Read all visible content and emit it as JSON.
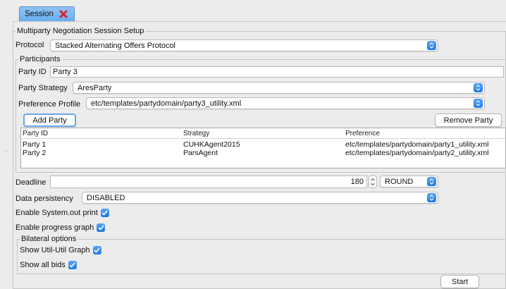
{
  "tab": {
    "label": "Session"
  },
  "setup": {
    "legend": "Multiparty Negotiation Session Setup",
    "protocol_label": "Protocol",
    "protocol_value": "Stacked Alternating Offers Protocol"
  },
  "participants": {
    "legend": "Participants",
    "party_id_label": "Party ID",
    "party_id_value": "Party 3",
    "strategy_label": "Party Strategy",
    "strategy_value": "AresParty",
    "profile_label": "Preference Profile",
    "profile_value": "etc/templates/partydomain/party3_utility.xml",
    "add_button": "Add Party",
    "remove_button": "Remove Party",
    "table": {
      "headers": [
        "Party ID",
        "Strategy",
        "Preference"
      ],
      "rows": [
        [
          "Party 1",
          "CUHKAgent2015",
          "etc/templates/partydomain/party1_utility.xml"
        ],
        [
          "Party 2",
          "ParsAgent",
          "etc/templates/partydomain/party2_utility.xml"
        ]
      ]
    }
  },
  "deadline": {
    "label": "Deadline",
    "value": "180",
    "unit": "ROUND"
  },
  "persistency": {
    "label": "Data persistency",
    "value": "DISABLED"
  },
  "options": {
    "system_out": "Enable System.out print",
    "progress_graph": "Enable progress graph"
  },
  "bilateral": {
    "legend": "Bilateral options",
    "util_graph": "Show Util-Util Graph",
    "all_bids": "Show all bids"
  },
  "start_button": "Start",
  "colors": {
    "accent": "#2f83ee",
    "tab": "#7ab8f3",
    "close": "#d6262d"
  }
}
